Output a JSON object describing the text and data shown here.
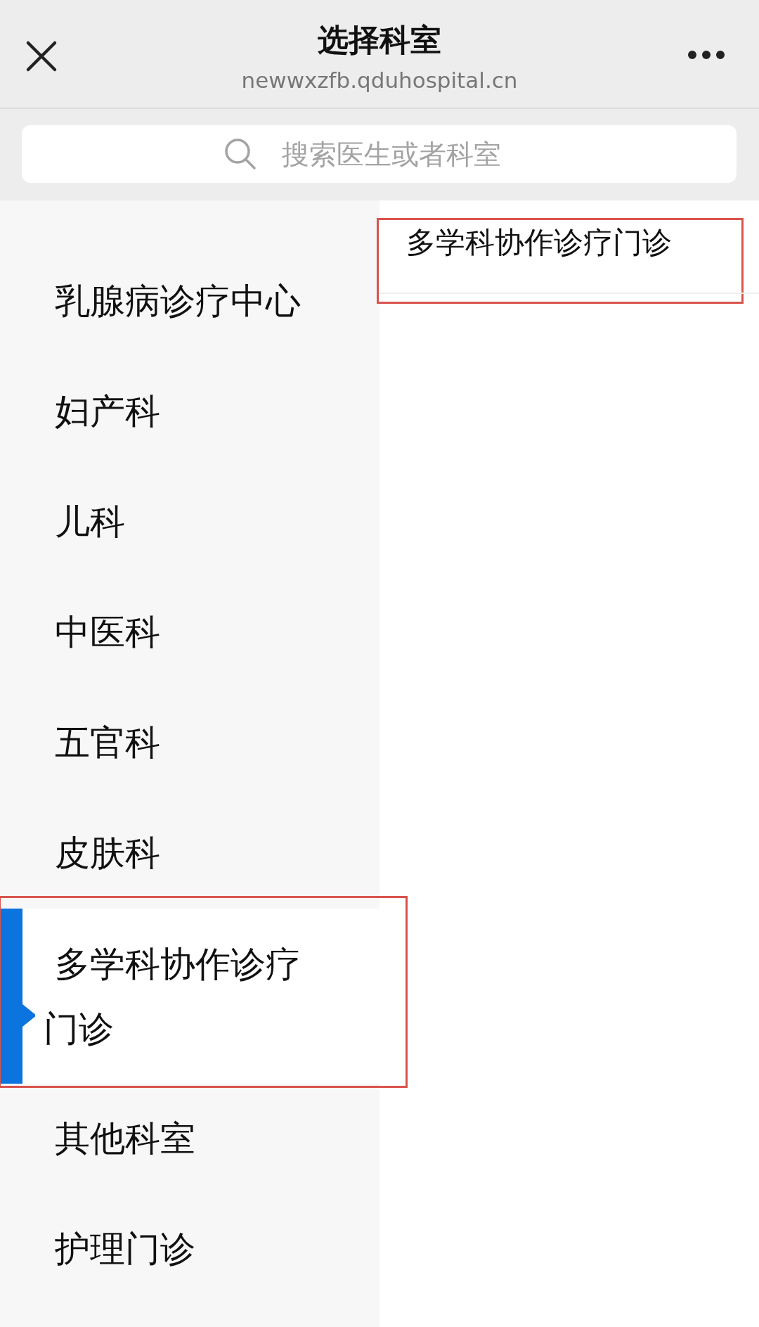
{
  "header": {
    "title": "选择科室",
    "url": "newwxzfb.qduhospital.cn"
  },
  "search": {
    "placeholder": "搜索医生或者科室"
  },
  "departments": [
    {
      "label": "乳腺病诊疗中心",
      "selected": false,
      "highlighted": false
    },
    {
      "label": "妇产科",
      "selected": false,
      "highlighted": false
    },
    {
      "label": "儿科",
      "selected": false,
      "highlighted": false
    },
    {
      "label": "中医科",
      "selected": false,
      "highlighted": false
    },
    {
      "label": "五官科",
      "selected": false,
      "highlighted": false
    },
    {
      "label": "皮肤科",
      "selected": false,
      "highlighted": false
    },
    {
      "label": "多学科协作诊疗门诊",
      "selected": true,
      "highlighted": true
    },
    {
      "label": "其他科室",
      "selected": false,
      "highlighted": false
    },
    {
      "label": "护理门诊",
      "selected": false,
      "highlighted": false
    }
  ],
  "subdepartments": [
    {
      "label": "多学科协作诊疗门诊",
      "highlighted": true
    }
  ]
}
